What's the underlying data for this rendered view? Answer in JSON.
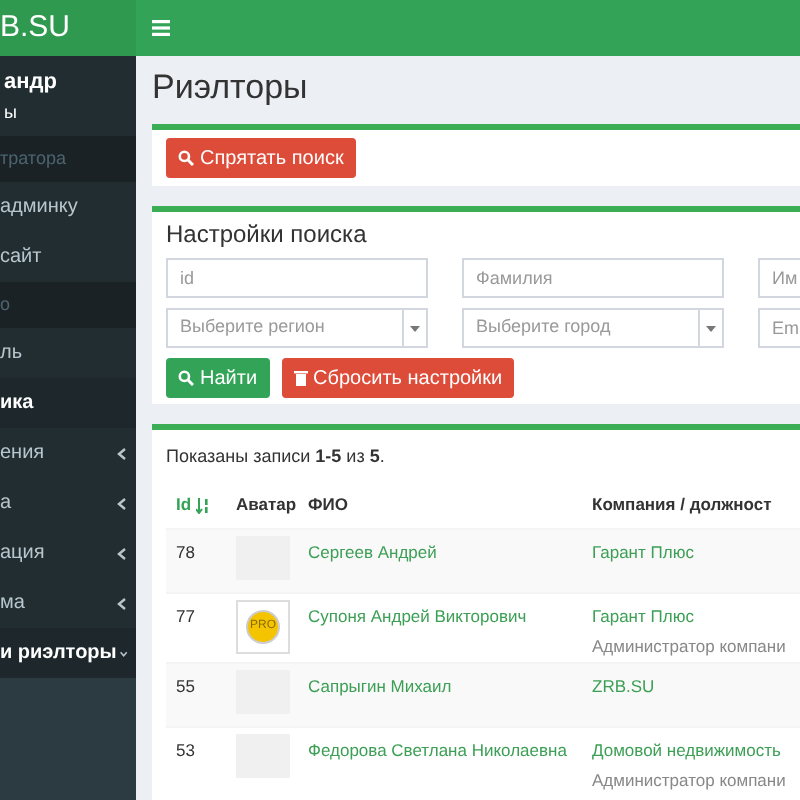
{
  "logo": "B.SU",
  "user": {
    "name": "андр",
    "subtitle": "ы"
  },
  "sidebar": {
    "items": [
      {
        "kind": "header",
        "label": "тратора"
      },
      {
        "kind": "link",
        "label": "админку",
        "selected": false
      },
      {
        "kind": "link",
        "label": "сайт",
        "selected": false
      },
      {
        "kind": "header",
        "label": "о"
      },
      {
        "kind": "link",
        "label": "ль",
        "selected": false
      },
      {
        "kind": "link",
        "label": "ика",
        "selected": true
      },
      {
        "kind": "tree",
        "label": "ения",
        "expanded": false,
        "selected": false
      },
      {
        "kind": "tree",
        "label": "а",
        "expanded": false,
        "selected": false
      },
      {
        "kind": "tree",
        "label": "ация",
        "expanded": false,
        "selected": false
      },
      {
        "kind": "tree",
        "label": "ма",
        "expanded": false,
        "selected": false
      },
      {
        "kind": "tree",
        "label": "и риэлторы",
        "expanded": true,
        "selected": true
      }
    ]
  },
  "page_title": "Риэлторы",
  "toggle_button": "Спрятать поиск",
  "search": {
    "title": "Настройки поиска",
    "fields": [
      {
        "kind": "input",
        "placeholder": "id"
      },
      {
        "kind": "input",
        "placeholder": "Фамилия"
      },
      {
        "kind": "input",
        "placeholder": "Им"
      },
      {
        "kind": "select",
        "placeholder": "Выберите регион"
      },
      {
        "kind": "select",
        "placeholder": "Выберите город"
      },
      {
        "kind": "input",
        "placeholder": "Em"
      }
    ],
    "find_button": "Найти",
    "reset_button": "Сбросить настройки"
  },
  "summary": "Показаны записи **1-5** из **5**.",
  "table": {
    "columns": [
      "Id",
      "Аватар",
      "ФИО",
      "Компания / должност"
    ],
    "rows": [
      {
        "id": "78",
        "avatar": {
          "kind": "empty"
        },
        "name": "Сергеев Андрей",
        "company": "Гарант Плюс"
      },
      {
        "id": "77",
        "avatar": {
          "kind": "pro",
          "label": "PRO"
        },
        "name": "Супоня Андрей Викторович",
        "company": "Гарант Плюс",
        "position": "Администратор компани"
      },
      {
        "id": "55",
        "avatar": {
          "kind": "empty"
        },
        "name": "Сапрыгин Михаил",
        "company": "ZRB.SU"
      },
      {
        "id": "53",
        "avatar": {
          "kind": "empty"
        },
        "name": "Федорова Светлана Николаевна",
        "company": "Домовой недвижимость",
        "position": "Администратор компани"
      }
    ]
  }
}
